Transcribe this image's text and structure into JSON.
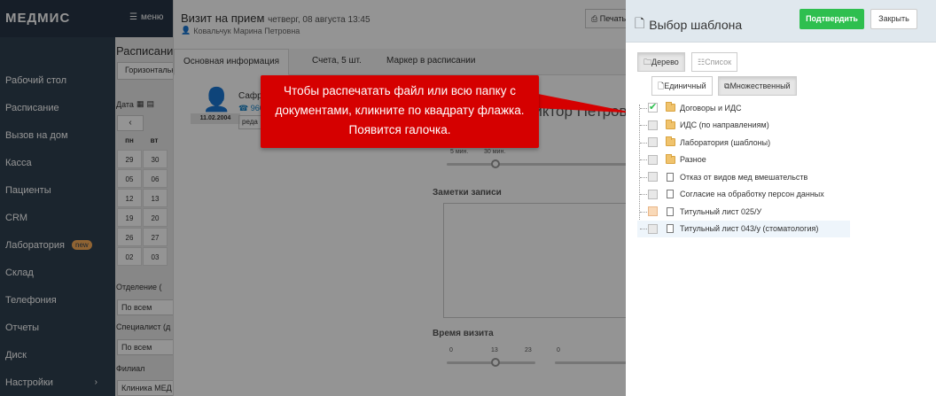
{
  "app": {
    "logo": "МЕДМИС",
    "menu_label": "меню"
  },
  "sidebar": {
    "items": [
      {
        "label": "Рабочий стол"
      },
      {
        "label": "Расписание"
      },
      {
        "label": "Вызов на дом"
      },
      {
        "label": "Касса"
      },
      {
        "label": "Пациенты"
      },
      {
        "label": "CRM"
      },
      {
        "label": "Лаборатория",
        "badge": "new"
      },
      {
        "label": "Склад"
      },
      {
        "label": "Телефония"
      },
      {
        "label": "Отчеты"
      },
      {
        "label": "Диск"
      },
      {
        "label": "Настройки",
        "chevron": "›"
      }
    ]
  },
  "schedule": {
    "title": "Расписание",
    "view_select": "Горизонтальное",
    "date_label": "Дата",
    "prev": "‹",
    "weekdays": [
      "пн",
      "вт"
    ],
    "weeks": [
      [
        "29",
        "30"
      ],
      [
        "05",
        "06"
      ],
      [
        "12",
        "13"
      ],
      [
        "19",
        "20"
      ],
      [
        "26",
        "27"
      ],
      [
        "02",
        "03"
      ]
    ],
    "department_label": "Отделение (",
    "department_value": "По всем",
    "specialist_label": "Специалист (д",
    "specialist_value": "По всем",
    "branch_label": "Филиал",
    "branch_value": "Клиника МЕД"
  },
  "visit": {
    "title": "Визит на прием",
    "date": "четверг, 08 августа 13:45",
    "doctor": "Ковальчук Марина Петровна",
    "print_label": "Печать",
    "tabs": [
      {
        "label": "Основная информация"
      },
      {
        "label": "Счета, 5 шт."
      },
      {
        "label": "Маркер в расписании"
      }
    ],
    "patient_name": "Сафро",
    "patient_phone": "960",
    "patient_dob": "11.02.2004",
    "patient_edit": "реда",
    "doctor_big": "Виктор Петров",
    "slider1_labels": [
      "5 мин.",
      "30 мин."
    ],
    "notes_label": "Заметки записи",
    "duration_label": "Время визита",
    "slider2_labels": [
      "0",
      "13",
      "23",
      "0"
    ]
  },
  "tooltip": {
    "text": "Чтобы распечатать файл или всю папку с документами, кликните по квадрату флажка. Появится галочка."
  },
  "template_panel": {
    "title": "Выбор шаблона",
    "confirm": "Подтвердить",
    "close": "Закрыть",
    "view_tree": "Дерево",
    "view_list": "Список",
    "mode_single": "Единичный",
    "mode_multi": "Множественный",
    "items": [
      {
        "label": "Договоры и ИДС",
        "type": "folder",
        "state": "checked"
      },
      {
        "label": "ИДС (по направлениям)",
        "type": "folder",
        "state": "none"
      },
      {
        "label": "Лаборатория (шаблоны)",
        "type": "folder",
        "state": "none"
      },
      {
        "label": "Разное",
        "type": "folder",
        "state": "none"
      },
      {
        "label": "Отказ от видов мед вмешательств",
        "type": "file",
        "state": "none"
      },
      {
        "label": "Согласие на обработку персон данных",
        "type": "file",
        "state": "none"
      },
      {
        "label": "Титульный лист 025/У",
        "type": "file",
        "state": "partial"
      },
      {
        "label": "Титульный лист 043/у (стоматология)",
        "type": "file",
        "state": "none"
      }
    ]
  },
  "colors": {
    "sidebar": "#2f4050",
    "confirm": "#2ebf4f",
    "tooltip": "#d50000"
  }
}
